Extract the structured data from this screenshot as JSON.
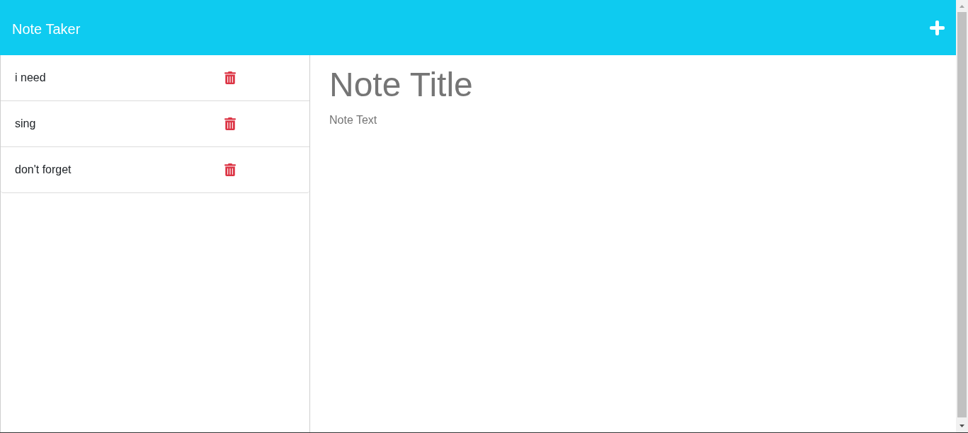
{
  "header": {
    "title": "Note Taker"
  },
  "notes": [
    {
      "title": "i need"
    },
    {
      "title": "sing"
    },
    {
      "title": "don't forget"
    }
  ],
  "editor": {
    "note_title": {
      "placeholder": "Note Title"
    },
    "note_text": {
      "placeholder": "Note Text"
    }
  }
}
